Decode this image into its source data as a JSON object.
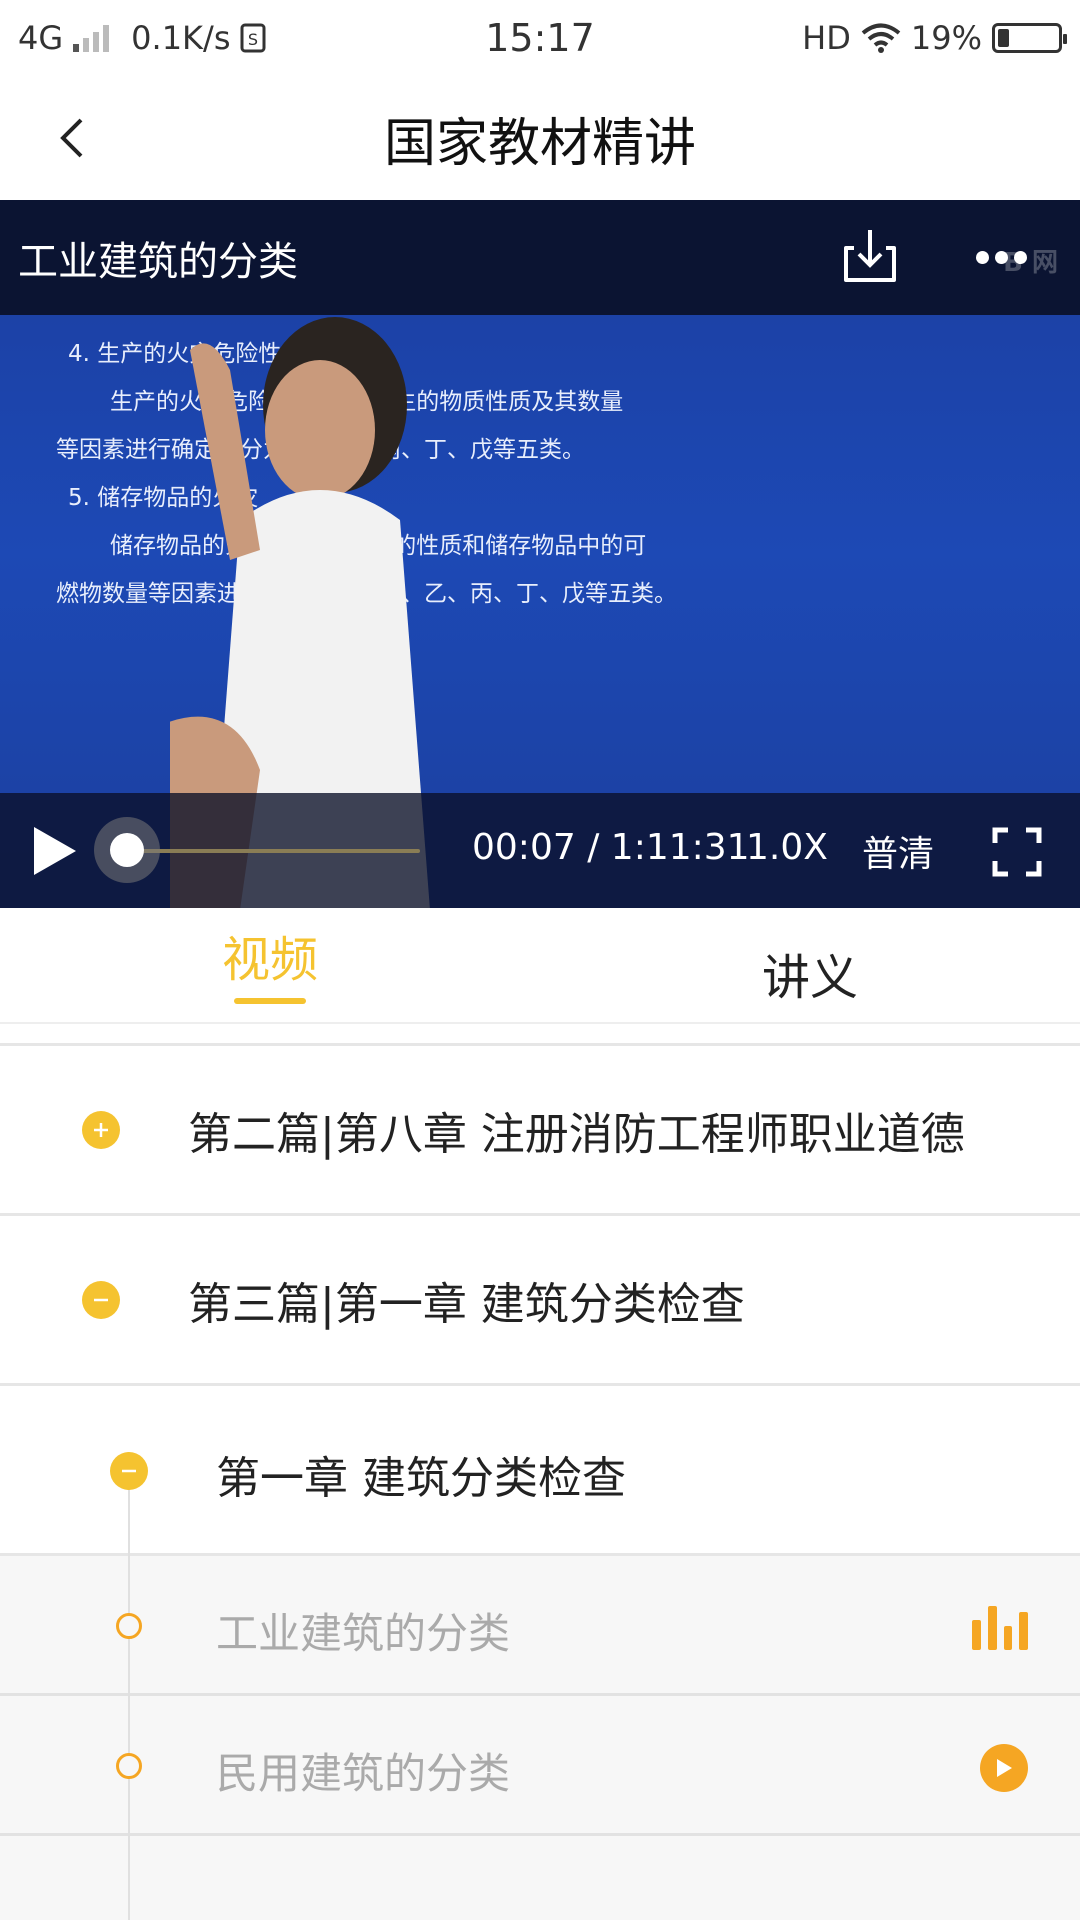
{
  "status_bar": {
    "network": "4G",
    "speed": "0.1K/s",
    "time": "15:17",
    "hd": "HD",
    "battery": "19%",
    "battery_level": 0.19
  },
  "header": {
    "title": "国家教材精讲"
  },
  "video": {
    "title": "工业建筑的分类",
    "watermark": "B 网",
    "slide_lines": [
      "4. 生产的火灾危险性",
      "生产的火灾危险性        使用或产生的物质性质及其数量",
      "等因素进行确定，分为甲、乙、丙、丁、戊等五类。",
      "5. 储存物品的火灾",
      "储存物品的火灾危险性        物品的性质和储存物品中的可",
      "燃物数量等因素进行确定，分为甲、乙、丙、丁、戊等五类。"
    ],
    "current_time": "00:07",
    "separator": "/",
    "duration": "1:11:31",
    "progress": 0.0016,
    "speed": "1.0X",
    "quality": "普清",
    "accent": "#f5c330"
  },
  "tabs": [
    {
      "label": "视频",
      "active": true
    },
    {
      "label": "讲义",
      "active": false
    }
  ],
  "list": {
    "sections": [
      {
        "title": "第二篇|第八章 注册消防工程师职业道德",
        "icon": "plus-icon",
        "expanded": false
      },
      {
        "title": "第三篇|第一章 建筑分类检查",
        "icon": "minus-icon",
        "expanded": true
      }
    ],
    "chapter": {
      "title": "第一章 建筑分类检查",
      "icon": "minus-icon"
    },
    "lessons": [
      {
        "title": "工业建筑的分类",
        "status_icon": "equalizer-icon",
        "playing": true
      },
      {
        "title": "民用建筑的分类",
        "status_icon": "play-circle-icon",
        "playing": false
      }
    ]
  }
}
